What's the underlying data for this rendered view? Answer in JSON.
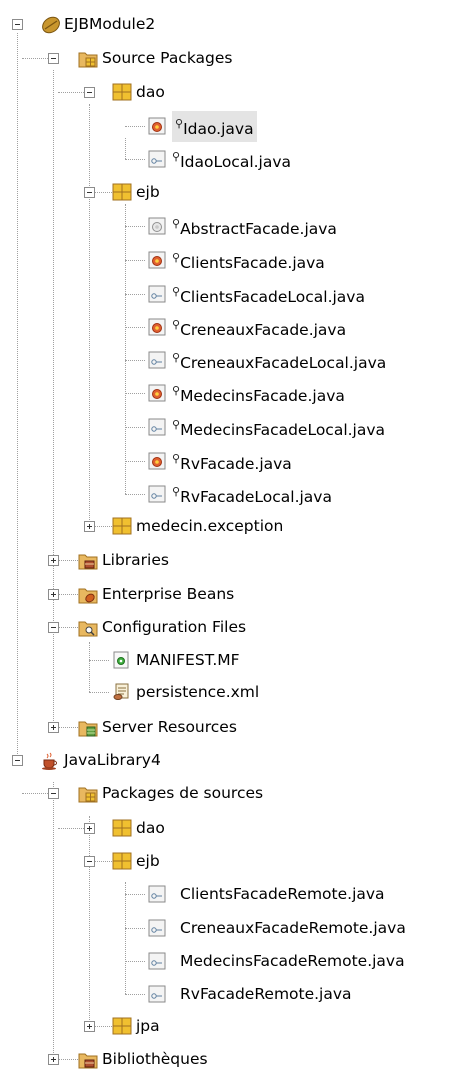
{
  "tree": {
    "ejb_module": {
      "label": "EJBModule2",
      "source_packages": {
        "label": "Source Packages",
        "dao": {
          "label": "dao",
          "files": [
            "Idao.java",
            "IdaoLocal.java"
          ]
        },
        "ejb": {
          "label": "ejb",
          "files": [
            "AbstractFacade.java",
            "ClientsFacade.java",
            "ClientsFacadeLocal.java",
            "CreneauxFacade.java",
            "CreneauxFacadeLocal.java",
            "MedecinsFacade.java",
            "MedecinsFacadeLocal.java",
            "RvFacade.java",
            "RvFacadeLocal.java"
          ]
        },
        "medecin_exception": {
          "label": "medecin.exception"
        }
      },
      "libraries": {
        "label": "Libraries"
      },
      "enterprise_beans": {
        "label": "Enterprise Beans"
      },
      "configuration_files": {
        "label": "Configuration Files",
        "files": [
          "MANIFEST.MF",
          "persistence.xml"
        ]
      },
      "server_resources": {
        "label": "Server Resources"
      }
    },
    "java_library": {
      "label": "JavaLibrary4",
      "packages": {
        "label": "Packages de sources",
        "dao": {
          "label": "dao"
        },
        "ejb": {
          "label": "ejb",
          "files": [
            "ClientsFacadeRemote.java",
            "CreneauxFacadeRemote.java",
            "MedecinsFacadeRemote.java",
            "RvFacadeRemote.java"
          ]
        },
        "jpa": {
          "label": "jpa"
        }
      },
      "libraries": {
        "label": "Bibliothèques"
      }
    }
  },
  "selected_item": "Idao.java",
  "colors": {
    "selection": "#e4e4e4",
    "package_yellow": "#f0c030",
    "folder": "#e8b860",
    "connector": "#a0a0a0"
  }
}
